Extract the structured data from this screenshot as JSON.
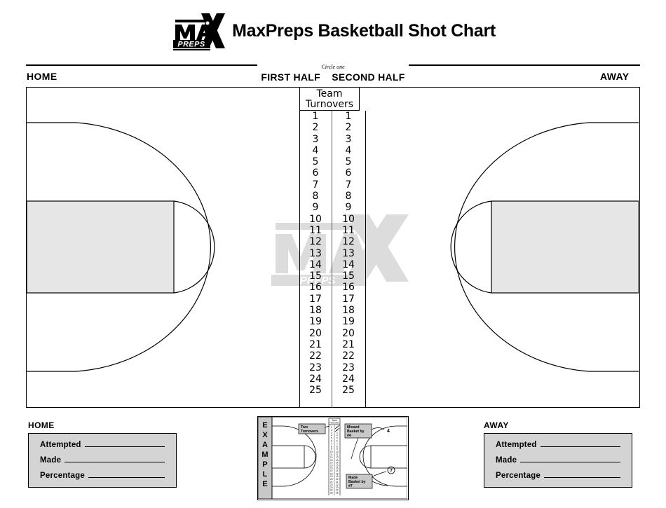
{
  "header": {
    "title": "MaxPreps Basketball Shot Chart",
    "logo_alt": "maxpreps-logo",
    "logo_text_top": "MAX",
    "logo_text_bottom": "PREPS"
  },
  "top_labels": {
    "home": "HOME",
    "away": "AWAY",
    "circle_one": "Circle one",
    "first_half": "FIRST HALF",
    "second_half": "SECOND HALF"
  },
  "turnovers": {
    "heading_line1": "Team",
    "heading_line2": "Turnovers",
    "column_left": [
      "1",
      "2",
      "3",
      "4",
      "5",
      "6",
      "7",
      "8",
      "9",
      "10",
      "11",
      "12",
      "13",
      "14",
      "15",
      "16",
      "17",
      "18",
      "19",
      "20",
      "21",
      "22",
      "23",
      "24",
      "25"
    ],
    "column_right": [
      "1",
      "2",
      "3",
      "4",
      "5",
      "6",
      "7",
      "8",
      "9",
      "10",
      "11",
      "12",
      "13",
      "14",
      "15",
      "16",
      "17",
      "18",
      "19",
      "20",
      "21",
      "22",
      "23",
      "24",
      "25"
    ]
  },
  "home_stats": {
    "title": "HOME",
    "rows": [
      {
        "label": "Attempted",
        "value": ""
      },
      {
        "label": "Made",
        "value": ""
      },
      {
        "label": "Percentage",
        "value": ""
      }
    ]
  },
  "away_stats": {
    "title": "AWAY",
    "rows": [
      {
        "label": "Attempted",
        "value": ""
      },
      {
        "label": "Made",
        "value": ""
      },
      {
        "label": "Percentage",
        "value": ""
      }
    ]
  },
  "example": {
    "label_letters": [
      "E",
      "X",
      "A",
      "M",
      "P",
      "L",
      "E"
    ],
    "mini_turnovers_heading_line1": "Team",
    "mini_turnovers_heading_line2": "Turnovers",
    "callout_turnovers_line1": "Two",
    "callout_turnovers_line2": "Turnovers",
    "callout_missed_line1": "Missed",
    "callout_missed_line2": "Basket by",
    "callout_missed_line3": "#4",
    "callout_made_line1": "Made",
    "callout_made_line2": "Basket by",
    "callout_made_line3": "#7",
    "mark_missed": "4",
    "mark_made": "7"
  },
  "colors": {
    "ink": "#000000",
    "key_fill": "#e6e6e6",
    "stat_box_fill": "#d4d4d4",
    "watermark": "#dcdcdc",
    "example_gray": "#c8c8c8"
  }
}
